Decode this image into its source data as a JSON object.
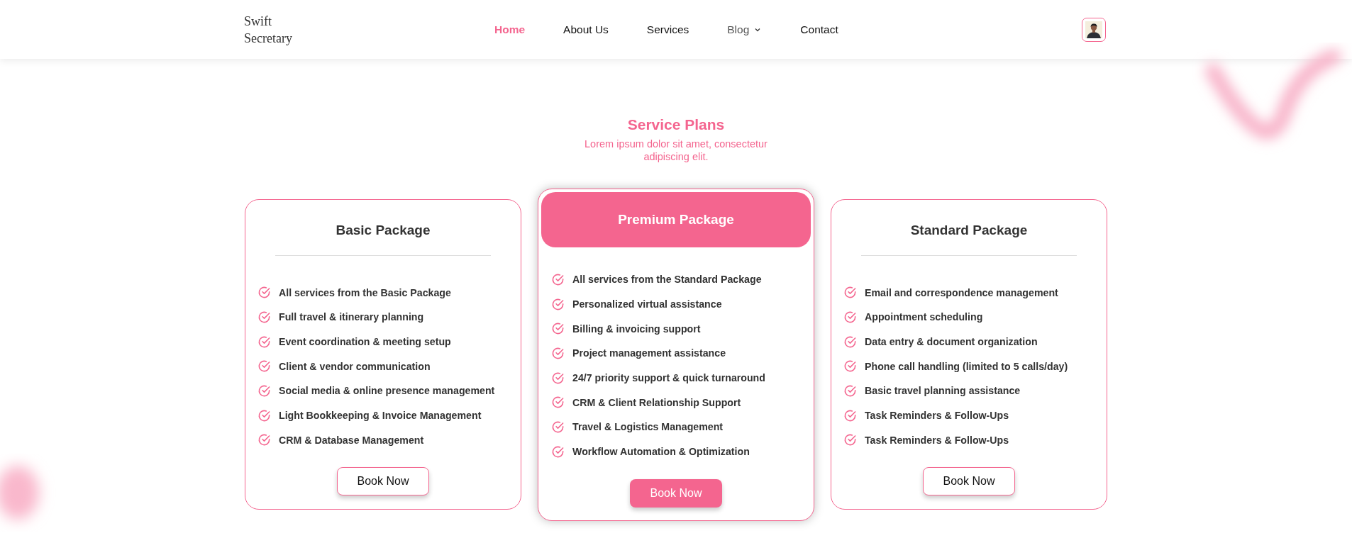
{
  "brand": {
    "line1": "Swift",
    "line2": "Secretary"
  },
  "nav": [
    {
      "label": "Home",
      "selected": true,
      "dropdown": false
    },
    {
      "label": "About Us",
      "selected": false,
      "dropdown": false
    },
    {
      "label": "Services",
      "selected": false,
      "dropdown": false
    },
    {
      "label": "Blog",
      "selected": false,
      "dropdown": true
    },
    {
      "label": "Contact",
      "selected": false,
      "dropdown": false
    }
  ],
  "section": {
    "title": "Service Plans",
    "subtitle": "Lorem ipsum dolor sit amet, consectetur adipiscing elit."
  },
  "plans": [
    {
      "title": "Basic Package",
      "featured": false,
      "features": [
        "All services from the Basic Package",
        "Full travel & itinerary planning",
        "Event coordination & meeting setup",
        "Client & vendor communication",
        "Social media & online presence management",
        "Light Bookkeeping & Invoice Management",
        "CRM & Database Management"
      ],
      "button": "Book Now"
    },
    {
      "title": "Premium Package",
      "featured": true,
      "features": [
        "All services from the Standard Package",
        "Personalized virtual assistance",
        "Billing & invoicing support",
        "Project management assistance",
        "24/7 priority support & quick turnaround",
        "CRM & Client Relationship Support",
        "Travel & Logistics Management",
        "Workflow Automation & Optimization"
      ],
      "button": "Book Now"
    },
    {
      "title": "Standard Package",
      "featured": false,
      "features": [
        "Email and correspondence management",
        "Appointment scheduling",
        "Data entry & document organization",
        "Phone call handling (limited to 5 calls/day)",
        "Basic travel planning assistance",
        "Task Reminders & Follow-Ups",
        "Task Reminders & Follow-Ups"
      ],
      "button": "Book Now"
    }
  ]
}
